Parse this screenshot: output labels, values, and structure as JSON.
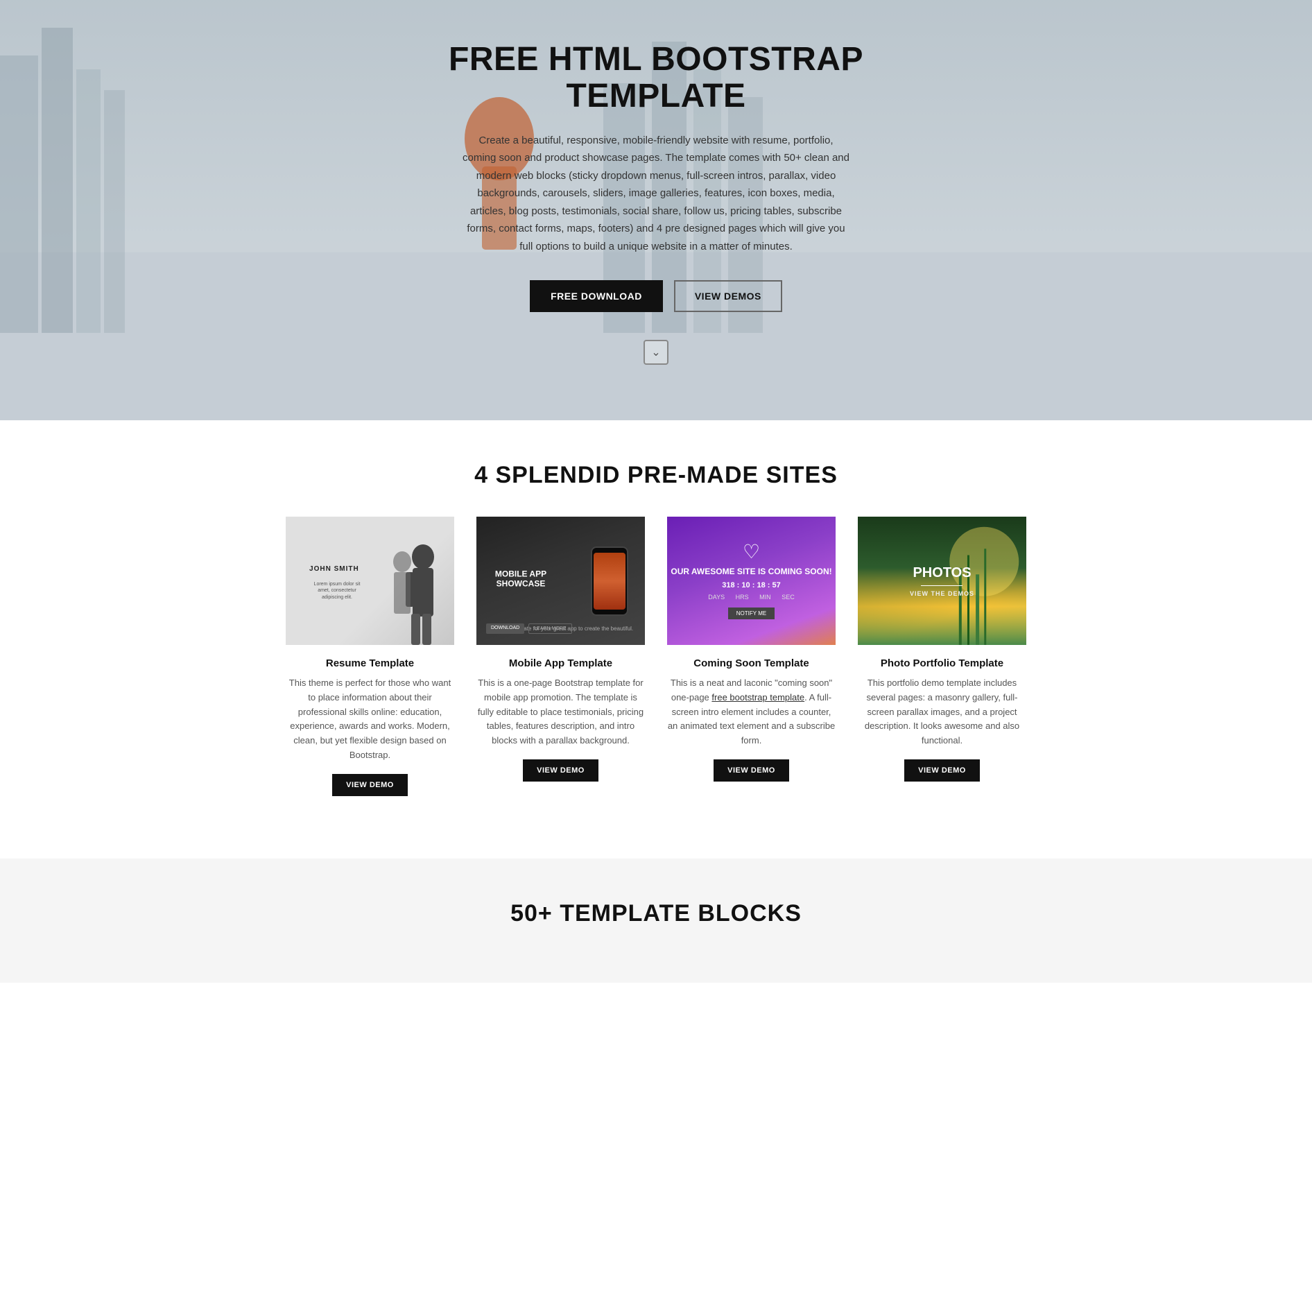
{
  "hero": {
    "title": "FREE HTML BOOTSTRAP TEMPLATE",
    "description": "Create a beautiful, responsive, mobile-friendly website with resume, portfolio, coming soon and product showcase pages. The template comes with 50+ clean and modern web blocks (sticky dropdown menus, full-screen intros, parallax, video backgrounds, carousels, sliders, image galleries, features, icon boxes, media, articles, blog posts, testimonials, social share, follow us, pricing tables, subscribe forms, contact forms, maps, footers) and 4 pre designed pages which will give you full options to build a unique website in a matter of minutes.",
    "btn_download": "FREE DOWNLOAD",
    "btn_demos": "VIEW DEMOS",
    "scroll_icon": "chevron-down"
  },
  "sites_section": {
    "title": "4 SPLENDID PRE-MADE SITES",
    "cards": [
      {
        "name": "Resume Template",
        "description": "This theme is perfect for those who want to place information about their professional skills online: education, experience, awards and works. Modern, clean, but yet flexible design based on Bootstrap.",
        "btn": "VIEW DEMO",
        "thumb_type": "resume"
      },
      {
        "name": "Mobile App Template",
        "description": "This is a one-page Bootstrap template for mobile app promotion. The template is fully editable to place testimonials, pricing tables, features description, and intro blocks with a parallax background.",
        "btn": "VIEW DEMO",
        "thumb_type": "mobile",
        "thumb_label": "MOBILE APP SHOWCASE"
      },
      {
        "name": "Coming Soon Template",
        "description": "This is a neat and laconic \"coming soon\" one-page free bootstrap template. A full-screen intro element includes a counter, an animated text element and a subscribe form.",
        "btn": "VIEW DEMO",
        "thumb_type": "coming",
        "coming_text": "OUR AWESOME SITE IS COMING SOON!",
        "counter": "318 : 10 : 18 : 57"
      },
      {
        "name": "Photo Portfolio Template",
        "description": "This portfolio demo template includes several pages: a masonry gallery, full-screen parallax images, and a project description. It looks awesome and also functional.",
        "btn": "VIEW DEMO",
        "thumb_type": "photo",
        "photo_title": "PHOTOS",
        "photo_sub": "VIEW THE DEMOS"
      }
    ]
  },
  "blocks_section": {
    "title": "50+ TEMPLATE BLOCKS"
  },
  "person_name": "JOHN SMITH"
}
